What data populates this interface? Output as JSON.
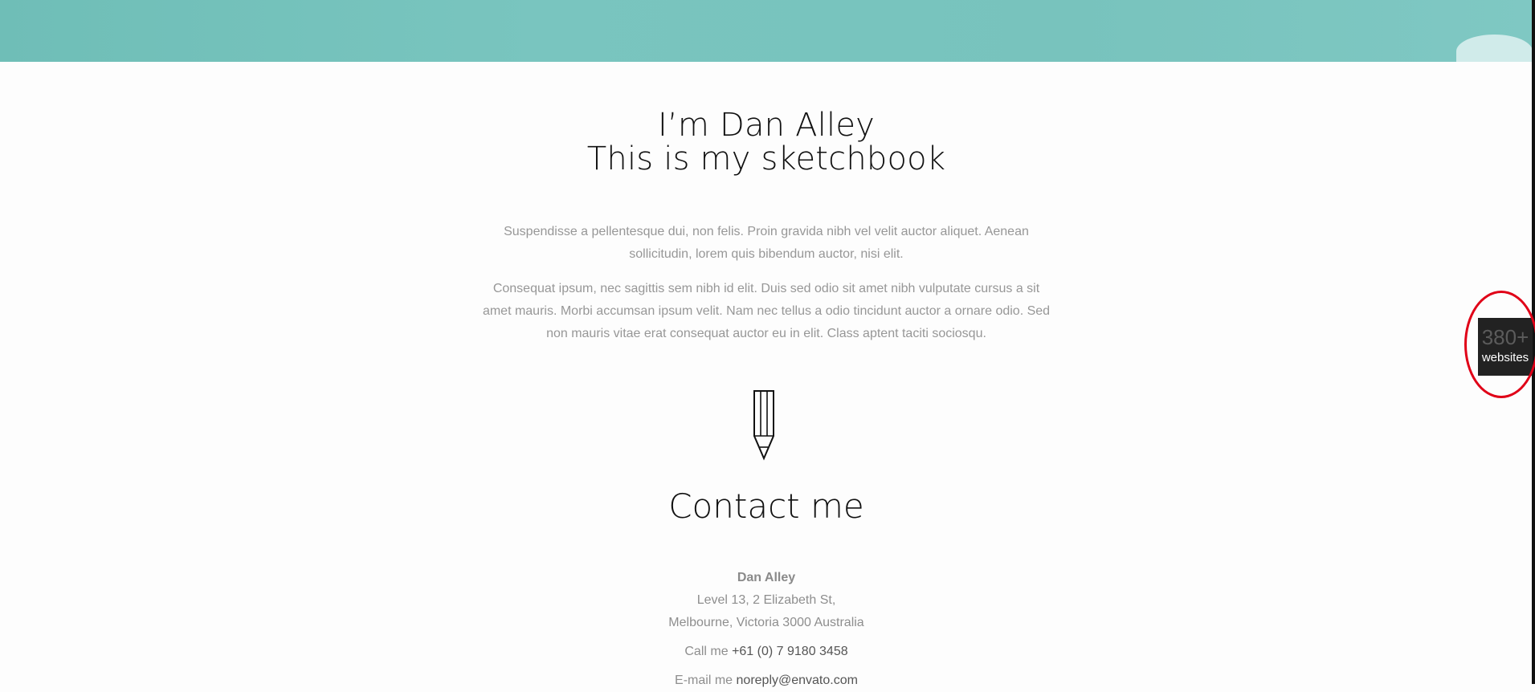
{
  "colors": {
    "banner": "#78c3bd",
    "page_background": "#fdfdfd",
    "accent_text": "#111111",
    "muted_text": "#979797",
    "widget_background": "#222222",
    "highlight_circle": "#e00017"
  },
  "hero": {
    "title_line_1": "I’m Dan Alley",
    "title_line_2": "This is my sketchbook"
  },
  "intro": {
    "paragraph_1": "Suspendisse a pellentesque dui, non felis. Proin gravida nibh vel velit auctor aliquet. Aenean sollicitudin, lorem quis bibendum auctor, nisi elit.",
    "paragraph_2": "Consequat ipsum, nec sagittis sem nibh id elit. Duis sed odio sit amet nibh vulputate cursus a sit amet mauris. Morbi accumsan ipsum velit. Nam nec tellus a odio tincidunt auctor a ornare odio. Sed non mauris vitae erat consequat auctor eu in elit. Class aptent taciti sociosqu."
  },
  "icons": {
    "pencil": "pencil-icon"
  },
  "contact": {
    "title": "Contact me",
    "name": "Dan Alley",
    "address_line_1": "Level 13, 2 Elizabeth St,",
    "address_line_2": "Melbourne, Victoria 3000 Australia",
    "phone_label": "Call me",
    "phone": "+61 (0) 7 9180 3458",
    "email_label": "E-mail me",
    "email": "noreply@envato.com"
  },
  "widget": {
    "count": "380+",
    "label": "websites"
  }
}
